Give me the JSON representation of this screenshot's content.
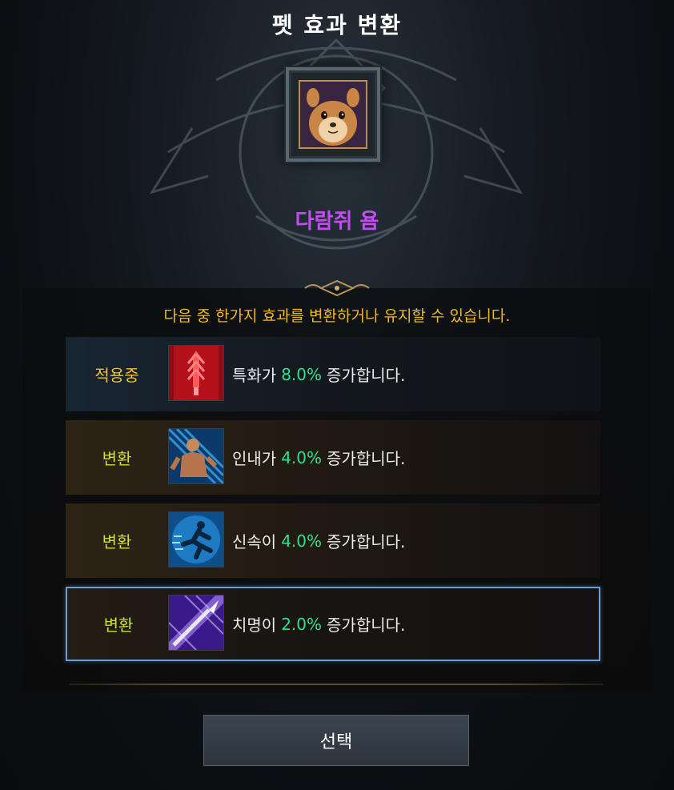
{
  "header": {
    "title": "펫 효과 변환"
  },
  "pet": {
    "name": "다람쥐 욤",
    "portrait_icon": "squirrel-portrait-icon",
    "name_color": "#c24ef0"
  },
  "instruction": "다음 중 한가지 효과를 변환하거나 유지할 수 있습니다.",
  "options": [
    {
      "status": "적용중",
      "icon": "specialization-sword-icon",
      "stat": "특화가",
      "value": "8.0%",
      "suffix": "증가합니다.",
      "state": "current"
    },
    {
      "status": "변환",
      "icon": "endurance-fighter-icon",
      "stat": "인내가",
      "value": "4.0%",
      "suffix": "증가합니다.",
      "state": "convert"
    },
    {
      "status": "변환",
      "icon": "swiftness-runner-icon",
      "stat": "신속이",
      "value": "4.0%",
      "suffix": "증가합니다.",
      "state": "convert"
    },
    {
      "status": "변환",
      "icon": "crit-spear-icon",
      "stat": "치명이",
      "value": "2.0%",
      "suffix": "증가합니다.",
      "state": "selected"
    }
  ],
  "colors": {
    "title": "#ffffff",
    "instruction": "#f2b81c",
    "status_current": "#f1c232",
    "status_convert": "#c8e03a",
    "percent": "#2ee08e",
    "selected_border": "#6e9ecf"
  },
  "footer": {
    "select_label": "선택"
  }
}
